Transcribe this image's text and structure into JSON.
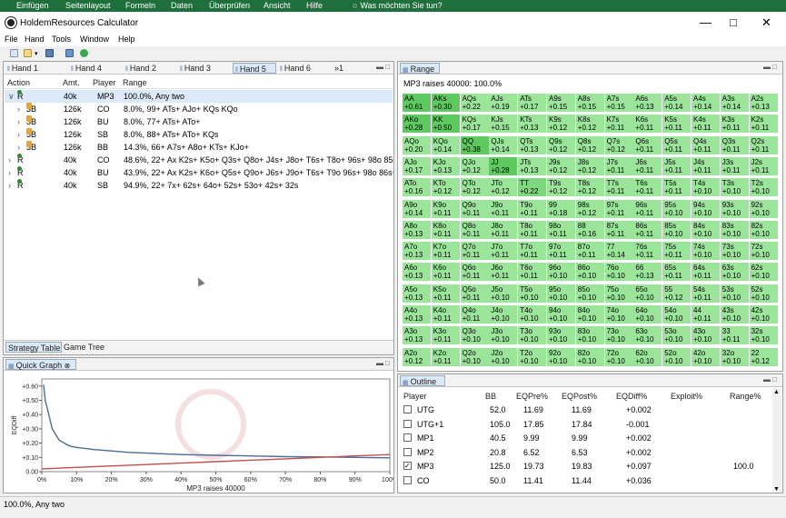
{
  "ribbon": {
    "items": [
      "Einfügen",
      "Seitenlayout",
      "Formeln",
      "Daten",
      "Überprüfen",
      "Ansicht",
      "Hilfe",
      "Was möchten Sie tun?"
    ]
  },
  "window": {
    "title": "HoldemResources Calculator"
  },
  "menu": {
    "items": [
      "File",
      "Hand",
      "Tools",
      "Window",
      "Help"
    ]
  },
  "hand_tabs": [
    "Hand 1",
    "Hand 4",
    "Hand 2",
    "Hand 3",
    "Hand 5",
    "Hand 6"
  ],
  "hand_tabs_overflow": "»1",
  "active_hand_tab": 4,
  "strategy": {
    "headers": {
      "action": "Action",
      "amount": "Amt.",
      "player": "Player",
      "range": "Range"
    },
    "rows": [
      {
        "expand": "∨",
        "action": "R",
        "amount": "40k",
        "player": "MP3",
        "range": "100.0%, Any two",
        "selected": true,
        "locked": false,
        "indent": 0
      },
      {
        "expand": "›",
        "action": "3B",
        "amount": "126k",
        "player": "CO",
        "range": "8.0%, 99+ ATs+ AJo+ KQs KQo",
        "selected": false,
        "locked": true,
        "indent": 1
      },
      {
        "expand": "›",
        "action": "3B",
        "amount": "126k",
        "player": "BU",
        "range": "8.0%, 77+ ATs+ ATo+",
        "selected": false,
        "locked": true,
        "indent": 1
      },
      {
        "expand": "›",
        "action": "3B",
        "amount": "126k",
        "player": "SB",
        "range": "8.0%, 88+ ATs+ ATo+ KQs",
        "selected": false,
        "locked": true,
        "indent": 1
      },
      {
        "expand": "›",
        "action": "3B",
        "amount": "126k",
        "player": "BB",
        "range": "14.3%, 66+ A7s+ A8o+ KTs+ KJo+",
        "selected": false,
        "locked": true,
        "indent": 1
      },
      {
        "expand": "›",
        "action": "R",
        "amount": "40k",
        "player": "CO",
        "range": "48.6%, 22+ Ax K2s+ K5o+ Q3s+ Q8o+ J4s+ J8o+ T6s+ T8o+ 96s+ 98o 85s",
        "selected": false,
        "locked": false,
        "indent": 0
      },
      {
        "expand": "›",
        "action": "R",
        "amount": "40k",
        "player": "BU",
        "range": "43.9%, 22+ Ax K2s+ K6o+ Q5s+ Q9o+ J6s+ J9o+ T6s+ T9o 96s+ 98o 86s+",
        "selected": false,
        "locked": false,
        "indent": 0
      },
      {
        "expand": "›",
        "action": "R",
        "amount": "40k",
        "player": "SB",
        "range": "94.9%, 22+ 7x+ 62s+ 64o+ 52s+ 53o+ 42s+ 32s",
        "selected": false,
        "locked": false,
        "indent": 0
      }
    ],
    "bottom_tabs": [
      "Strategy Table",
      "Game Tree"
    ]
  },
  "range_panel": {
    "tab": "Range",
    "title": "MP3 raises 40000: 100.0%",
    "ranks": [
      "A",
      "K",
      "Q",
      "J",
      "T",
      "9",
      "8",
      "7",
      "6",
      "5",
      "4",
      "3",
      "2"
    ],
    "values": [
      [
        "+0.61",
        "+0.30",
        "+0.22",
        "+0.19",
        "+0.17",
        "+0.15",
        "+0.15",
        "+0.15",
        "+0.13",
        "+0.14",
        "+0.14",
        "+0.14",
        "+0.13"
      ],
      [
        "+0.28",
        "+0.50",
        "+0.17",
        "+0.15",
        "+0.13",
        "+0.12",
        "+0.12",
        "+0.11",
        "+0.11",
        "+0.11",
        "+0.11",
        "+0.11",
        "+0.11"
      ],
      [
        "+0.20",
        "+0.14",
        "+0.38",
        "+0.14",
        "+0.13",
        "+0.12",
        "+0.12",
        "+0.12",
        "+0.11",
        "+0.11",
        "+0.11",
        "+0.11",
        "+0.11"
      ],
      [
        "+0.17",
        "+0.13",
        "+0.12",
        "+0.28",
        "+0.13",
        "+0.12",
        "+0.12",
        "+0.11",
        "+0.11",
        "+0.11",
        "+0.11",
        "+0.11",
        "+0.11"
      ],
      [
        "+0.16",
        "+0.12",
        "+0.12",
        "+0.12",
        "+0.22",
        "+0.12",
        "+0.12",
        "+0.11",
        "+0.11",
        "+0.11",
        "+0.10",
        "+0.10",
        "+0.10"
      ],
      [
        "+0.14",
        "+0.11",
        "+0.11",
        "+0.11",
        "+0.11",
        "+0.18",
        "+0.12",
        "+0.11",
        "+0.11",
        "+0.10",
        "+0.10",
        "+0.10",
        "+0.10"
      ],
      [
        "+0.13",
        "+0.11",
        "+0.11",
        "+0.11",
        "+0.11",
        "+0.11",
        "+0.16",
        "+0.11",
        "+0.11",
        "+0.10",
        "+0.10",
        "+0.10",
        "+0.10"
      ],
      [
        "+0.13",
        "+0.11",
        "+0.11",
        "+0.11",
        "+0.11",
        "+0.11",
        "+0.11",
        "+0.14",
        "+0.11",
        "+0.11",
        "+0.10",
        "+0.10",
        "+0.10"
      ],
      [
        "+0.13",
        "+0.11",
        "+0.11",
        "+0.11",
        "+0.11",
        "+0.10",
        "+0.10",
        "+0.10",
        "+0.13",
        "+0.11",
        "+0.11",
        "+0.10",
        "+0.10"
      ],
      [
        "+0.13",
        "+0.11",
        "+0.11",
        "+0.10",
        "+0.10",
        "+0.10",
        "+0.10",
        "+0.10",
        "+0.10",
        "+0.12",
        "+0.11",
        "+0.10",
        "+0.10"
      ],
      [
        "+0.13",
        "+0.11",
        "+0.11",
        "+0.10",
        "+0.10",
        "+0.10",
        "+0.10",
        "+0.10",
        "+0.10",
        "+0.10",
        "+0.11",
        "+0.10",
        "+0.10"
      ],
      [
        "+0.13",
        "+0.11",
        "+0.10",
        "+0.10",
        "+0.10",
        "+0.10",
        "+0.10",
        "+0.10",
        "+0.10",
        "+0.10",
        "+0.10",
        "+0.11",
        "+0.10"
      ],
      [
        "+0.12",
        "+0.11",
        "+0.10",
        "+0.10",
        "+0.10",
        "+0.10",
        "+0.10",
        "+0.10",
        "+0.10",
        "+0.10",
        "+0.10",
        "+0.10",
        "+0.12"
      ]
    ],
    "highlight": [
      "AA",
      "KK",
      "QQ",
      "JJ",
      "TT"
    ],
    "colors": {
      "strong": "#5ec95e",
      "normal": "#9be59b",
      "pair": "#7ed67e"
    }
  },
  "quick_graph": {
    "tab": "Quick Graph",
    "chart_data": {
      "type": "line",
      "xlabel": "MP3 raises 40000",
      "ylabel": "EQDiff",
      "x_ticks": [
        "0%",
        "10%",
        "20%",
        "30%",
        "40%",
        "50%",
        "60%",
        "70%",
        "80%",
        "90%",
        "100%"
      ],
      "y_ticks": [
        "0.00",
        "+0.10",
        "+0.20",
        "+0.30",
        "+0.40",
        "+0.50",
        "+0.60"
      ],
      "xlim": [
        0,
        100
      ],
      "ylim": [
        0,
        0.65
      ],
      "series": [
        {
          "color": "#4a6e9a",
          "x": [
            0.5,
            1,
            2,
            3,
            5,
            8,
            10,
            15,
            20,
            25,
            30,
            40,
            50,
            60,
            70,
            80,
            90,
            100
          ],
          "y": [
            0.61,
            0.5,
            0.4,
            0.3,
            0.22,
            0.18,
            0.17,
            0.155,
            0.145,
            0.135,
            0.13,
            0.12,
            0.115,
            0.11,
            0.105,
            0.103,
            0.1,
            0.097
          ]
        },
        {
          "color": "#c0504d",
          "x": [
            0,
            10,
            20,
            30,
            40,
            50,
            60,
            70,
            80,
            90,
            100
          ],
          "y": [
            0.02,
            0.03,
            0.04,
            0.05,
            0.06,
            0.07,
            0.08,
            0.09,
            0.1,
            0.11,
            0.12
          ]
        }
      ]
    }
  },
  "outline": {
    "tab": "Outline",
    "headers": [
      "Player",
      "BB",
      "EQPre%",
      "EQPost%",
      "EQDiff%",
      "Exploit%",
      "Range%"
    ],
    "rows": [
      {
        "checked": false,
        "player": "UTG",
        "bb": "52.0",
        "eqpre": "11.69",
        "eqpost": "11.69",
        "eqdiff": "+0.002",
        "exploit": "",
        "range": ""
      },
      {
        "checked": false,
        "player": "UTG+1",
        "bb": "105.0",
        "eqpre": "17.85",
        "eqpost": "17.84",
        "eqdiff": "-0.001",
        "exploit": "",
        "range": ""
      },
      {
        "checked": false,
        "player": "MP1",
        "bb": "40.5",
        "eqpre": "9.99",
        "eqpost": "9.99",
        "eqdiff": "+0.002",
        "exploit": "",
        "range": ""
      },
      {
        "checked": false,
        "player": "MP2",
        "bb": "20.8",
        "eqpre": "6.52",
        "eqpost": "6.53",
        "eqdiff": "+0.002",
        "exploit": "",
        "range": ""
      },
      {
        "checked": true,
        "player": "MP3",
        "bb": "125.0",
        "eqpre": "19.73",
        "eqpost": "19.83",
        "eqdiff": "+0.097",
        "exploit": "",
        "range": "100.0"
      },
      {
        "checked": false,
        "player": "CO",
        "bb": "50.0",
        "eqpre": "11.41",
        "eqpost": "11.44",
        "eqdiff": "+0.036",
        "exploit": "",
        "range": ""
      }
    ]
  },
  "statusbar": {
    "text": "100.0%, Any two"
  }
}
